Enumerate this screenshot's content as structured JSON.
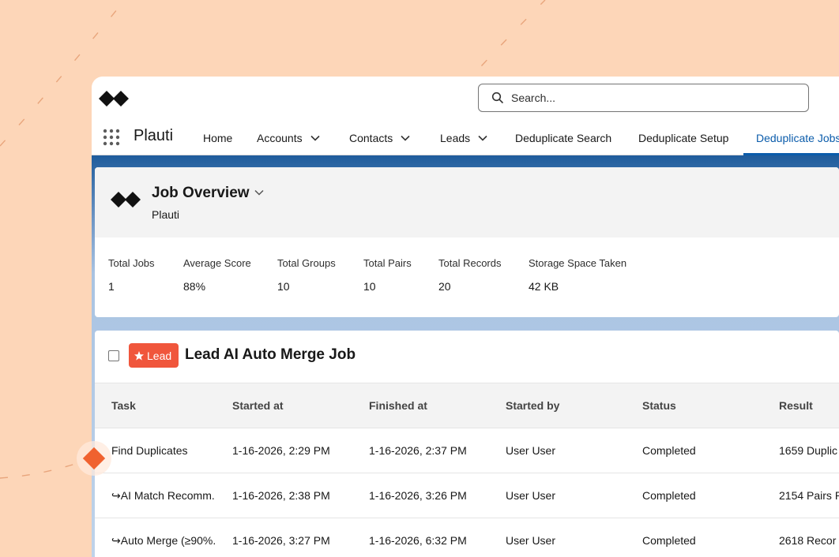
{
  "colors": {
    "background": "#fdd6b8",
    "accent_blue": "#0b5cab",
    "lead_badge": "#f0563c",
    "marker": "#f0622f"
  },
  "search": {
    "placeholder": "Search...",
    "icon": "search-icon"
  },
  "nav": {
    "app_name": "Plauti",
    "items": [
      {
        "label": "Home",
        "dropdown": false
      },
      {
        "label": "Accounts",
        "dropdown": true
      },
      {
        "label": "Contacts",
        "dropdown": true
      },
      {
        "label": "Leads",
        "dropdown": true
      },
      {
        "label": "Deduplicate Search",
        "dropdown": false
      },
      {
        "label": "Deduplicate Setup",
        "dropdown": false
      },
      {
        "label": "Deduplicate Jobs",
        "dropdown": false,
        "active": true
      }
    ]
  },
  "overview": {
    "title": "Job Overview",
    "subtitle": "Plauti",
    "stats": [
      {
        "label": "Total Jobs",
        "value": "1"
      },
      {
        "label": "Average Score",
        "value": "88%"
      },
      {
        "label": "Total Groups",
        "value": "10"
      },
      {
        "label": "Total Pairs",
        "value": "10"
      },
      {
        "label": "Total Records",
        "value": "20"
      },
      {
        "label": "Storage Space Taken",
        "value": "42 KB"
      }
    ]
  },
  "job": {
    "badge": "Lead",
    "title": "Lead AI Auto Merge Job",
    "columns": [
      "Task",
      "Started at",
      "Finished at",
      "Started by",
      "Status",
      "Result"
    ],
    "rows": [
      [
        "Find Duplicates",
        "1-16-2026, 2:29 PM",
        "1-16-2026, 2:37 PM",
        "User User",
        "Completed",
        "1659 Duplic"
      ],
      [
        "↪AI Match Recomm...",
        "1-16-2026, 2:38 PM",
        "1-16-2026, 3:26 PM",
        "User User",
        "Completed",
        "2154 Pairs P"
      ],
      [
        "↪Auto Merge (≥90%...",
        "1-16-2026, 3:27 PM",
        "1-16-2026, 6:32 PM",
        "User User",
        "Completed",
        "2618 Recor"
      ]
    ]
  }
}
